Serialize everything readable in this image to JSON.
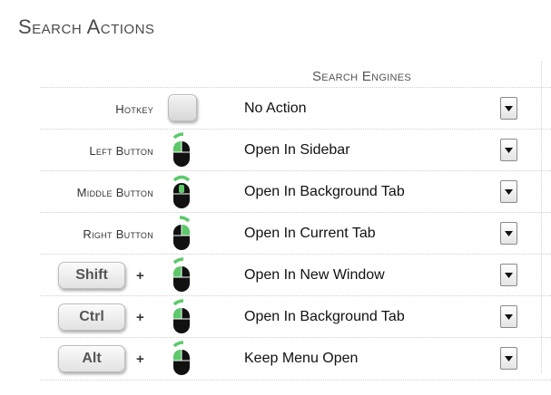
{
  "page": {
    "title": "Search Actions"
  },
  "table": {
    "column_header": "Search Engines",
    "rows": [
      {
        "label": "Hotkey",
        "modifier": "",
        "action": "No Action",
        "icon": "hotkey-icon"
      },
      {
        "label": "Left Button",
        "modifier": "",
        "action": "Open In Sidebar",
        "icon": "mouse-left-button-icon"
      },
      {
        "label": "Middle Button",
        "modifier": "",
        "action": "Open In Background Tab",
        "icon": "mouse-middle-button-icon"
      },
      {
        "label": "Right Button",
        "modifier": "",
        "action": "Open In Current Tab",
        "icon": "mouse-right-button-icon"
      },
      {
        "label": "",
        "modifier": "Shift",
        "plus": "+",
        "action": "Open In New Window",
        "icon": "mouse-left-button-icon"
      },
      {
        "label": "",
        "modifier": "Ctrl",
        "plus": "+",
        "action": "Open In Background Tab",
        "icon": "mouse-left-button-icon"
      },
      {
        "label": "",
        "modifier": "Alt",
        "plus": "+",
        "action": "Keep Menu Open",
        "icon": "mouse-left-button-icon"
      }
    ]
  },
  "colors": {
    "mouse_body": "#111111",
    "mouse_highlight": "#5cc96a",
    "title": "#4a4a4a"
  }
}
